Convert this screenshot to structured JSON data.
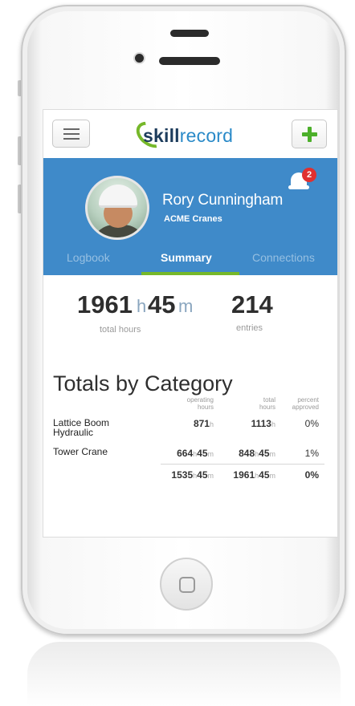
{
  "topbar": {
    "brand_part1": "skill",
    "brand_part2": "record"
  },
  "notifications": {
    "count": "2"
  },
  "profile": {
    "name": "Rory Cunningham",
    "company": "ACME Cranes"
  },
  "tabs": [
    {
      "label": "Logbook",
      "active": false
    },
    {
      "label": "Summary",
      "active": true
    },
    {
      "label": "Connections",
      "active": false
    }
  ],
  "stats": {
    "hours": "1961",
    "hours_unit": "h",
    "minutes": "45",
    "minutes_unit": "m",
    "hours_label": "total hours",
    "entries": "214",
    "entries_label": "entries"
  },
  "totals": {
    "title": "Totals by Category",
    "col_operating_1": "operating",
    "col_operating_2": "hours",
    "col_total_1": "total",
    "col_total_2": "hours",
    "col_percent_1": "percent",
    "col_percent_2": "approved",
    "rows": [
      {
        "category_line1": "Lattice Boom",
        "category_line2": "Hydraulic",
        "operating_h": "871",
        "operating_m": "",
        "total_h": "1113",
        "total_m": "",
        "percent": "0%"
      },
      {
        "category_line1": "Tower Crane",
        "category_line2": "",
        "operating_h": "664",
        "operating_m": "45",
        "total_h": "848",
        "total_m": "45",
        "percent": "1%"
      }
    ],
    "summary": {
      "operating_h": "1535",
      "operating_m": "45",
      "total_h": "1961",
      "total_m": "45",
      "percent": "0%"
    },
    "unit_h": "h",
    "unit_m": "m"
  },
  "colors": {
    "header_blue": "#3f8ac9",
    "accent_green": "#76b82a",
    "badge_red": "#e03030"
  }
}
